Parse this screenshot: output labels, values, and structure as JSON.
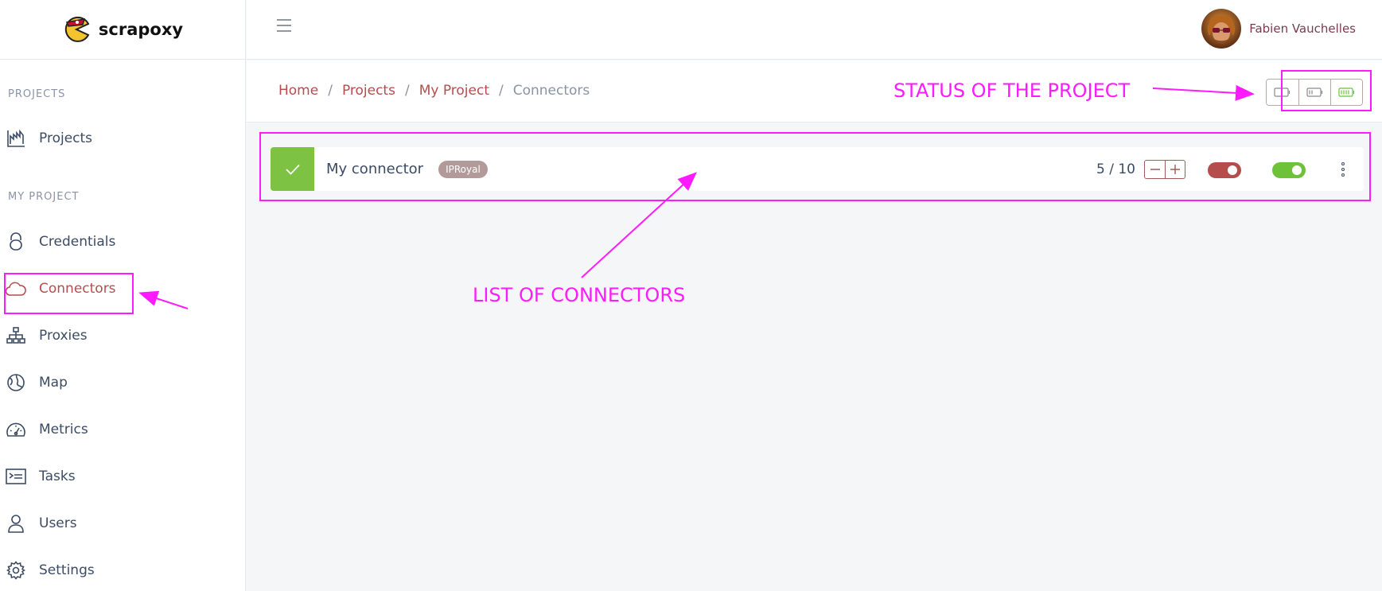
{
  "brand": {
    "name": "scrapoxy"
  },
  "sidebar": {
    "sections": [
      {
        "title": "PROJECTS"
      },
      {
        "title": "MY PROJECT"
      }
    ],
    "items": [
      {
        "label": "Projects",
        "icon": "chart-icon"
      },
      {
        "label": "Credentials",
        "icon": "lock-icon"
      },
      {
        "label": "Connectors",
        "icon": "cloud-icon",
        "active": true
      },
      {
        "label": "Proxies",
        "icon": "sitemap-icon"
      },
      {
        "label": "Map",
        "icon": "globe-icon"
      },
      {
        "label": "Metrics",
        "icon": "speedometer-icon"
      },
      {
        "label": "Tasks",
        "icon": "terminal-icon"
      },
      {
        "label": "Users",
        "icon": "user-icon"
      },
      {
        "label": "Settings",
        "icon": "gear-icon"
      }
    ]
  },
  "header": {
    "user_name": "Fabien Vauchelles"
  },
  "breadcrumb": {
    "items": [
      "Home",
      "Projects",
      "My Project"
    ],
    "separator": "/",
    "current": "Connectors"
  },
  "status": {
    "options": [
      "battery-empty-icon",
      "battery-half-icon",
      "battery-full-icon"
    ],
    "active_color": "#6ec23a"
  },
  "connector": {
    "name": "My connector",
    "badge": "IPRoyal",
    "count": "5 / 10",
    "active_toggle": false,
    "running_toggle": true
  },
  "annotations": {
    "status_label": "STATUS OF THE PROJECT",
    "list_label": "LIST OF CONNECTORS",
    "color": "#ff1aff"
  },
  "colors": {
    "accent": "#b54d4d",
    "success": "#7dc243",
    "annotation": "#ff1aff"
  }
}
